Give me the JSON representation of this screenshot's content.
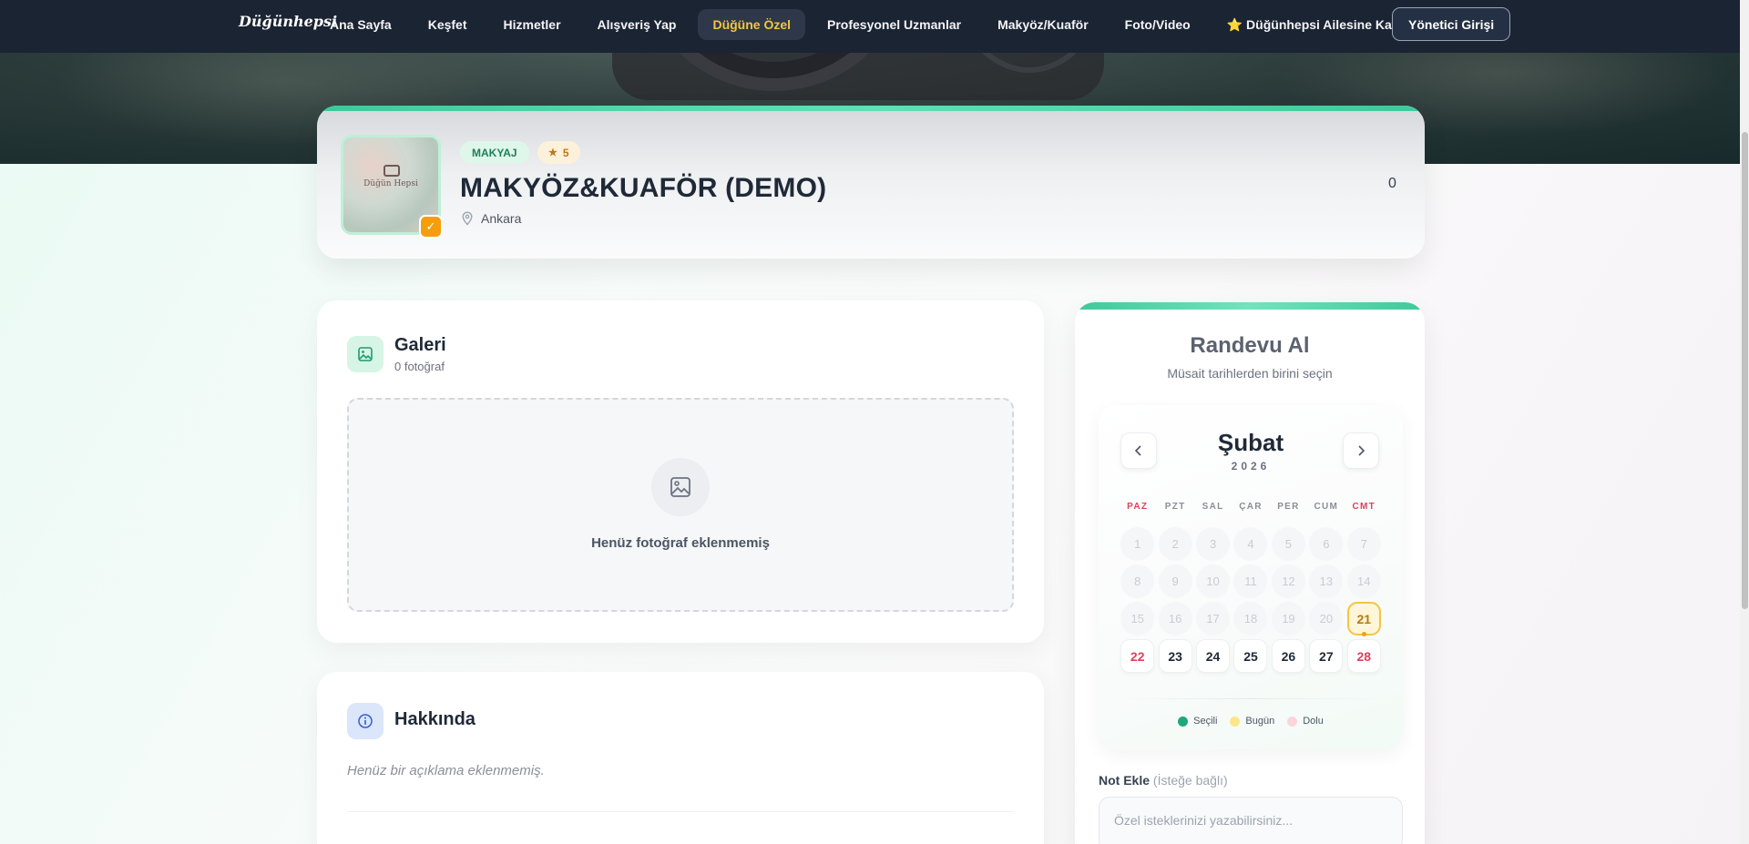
{
  "nav": {
    "logo": "Düğünhepsi",
    "items": [
      {
        "label": "Ana Sayfa",
        "active": false
      },
      {
        "label": "Keşfet",
        "active": false
      },
      {
        "label": "Hizmetler",
        "active": false
      },
      {
        "label": "Alışveriş Yap",
        "active": false
      },
      {
        "label": "Düğüne Özel",
        "active": true
      },
      {
        "label": "Profesyonel Uzmanlar",
        "active": false
      },
      {
        "label": "Makyöz/Kuaför",
        "active": false
      },
      {
        "label": "Foto/Video",
        "active": false
      },
      {
        "label": "⭐ Düğünhepsi Ailesine Katılın",
        "active": false
      }
    ],
    "admin_label": "Yönetici Girişi"
  },
  "vendor": {
    "category": "MAKYAJ",
    "rating": "5",
    "name": "MAKYÖZ&KUAFÖR (DEMO)",
    "location": "Ankara",
    "count": "0",
    "avatar_text": "Düğün Hepsi"
  },
  "gallery": {
    "title": "Galeri",
    "subtitle": "0 fotoğraf",
    "empty_text": "Henüz fotoğraf eklenmemiş"
  },
  "about": {
    "title": "Hakkında",
    "text": "Henüz bir açıklama eklenmemiş."
  },
  "booking": {
    "title": "Randevu Al",
    "subtitle": "Müsait tarihlerden birini seçin",
    "month": "Şubat",
    "year": "2026",
    "weekdays": [
      "PAZ",
      "PZT",
      "SAL",
      "ÇAR",
      "PER",
      "CUM",
      "CMT"
    ],
    "days": [
      {
        "n": "1",
        "state": "past"
      },
      {
        "n": "2",
        "state": "past"
      },
      {
        "n": "3",
        "state": "past"
      },
      {
        "n": "4",
        "state": "past"
      },
      {
        "n": "5",
        "state": "past"
      },
      {
        "n": "6",
        "state": "past"
      },
      {
        "n": "7",
        "state": "past"
      },
      {
        "n": "8",
        "state": "past"
      },
      {
        "n": "9",
        "state": "past"
      },
      {
        "n": "10",
        "state": "past"
      },
      {
        "n": "11",
        "state": "past"
      },
      {
        "n": "12",
        "state": "past"
      },
      {
        "n": "13",
        "state": "past"
      },
      {
        "n": "14",
        "state": "past"
      },
      {
        "n": "15",
        "state": "past"
      },
      {
        "n": "16",
        "state": "past"
      },
      {
        "n": "17",
        "state": "past"
      },
      {
        "n": "18",
        "state": "past"
      },
      {
        "n": "19",
        "state": "past"
      },
      {
        "n": "20",
        "state": "past"
      },
      {
        "n": "21",
        "state": "today"
      },
      {
        "n": "22",
        "state": "available"
      },
      {
        "n": "23",
        "state": "available"
      },
      {
        "n": "24",
        "state": "available"
      },
      {
        "n": "25",
        "state": "available"
      },
      {
        "n": "26",
        "state": "available"
      },
      {
        "n": "27",
        "state": "available"
      },
      {
        "n": "28",
        "state": "available"
      }
    ],
    "legend": [
      {
        "label": "Seçili",
        "color": "#1fa77a"
      },
      {
        "label": "Bugün",
        "color": "#fde68a"
      },
      {
        "label": "Dolu",
        "color": "#fbd5dc"
      }
    ],
    "note_label": "Not Ekle",
    "note_optional": "(İsteğe bağlı)",
    "note_placeholder": "Özel isteklerinizi yazabilirsiniz..."
  },
  "colors": {
    "accent": "#3ec99a",
    "nav_bg": "#1b2433",
    "highlight": "#f5c542",
    "weekend": "#e0405c"
  }
}
